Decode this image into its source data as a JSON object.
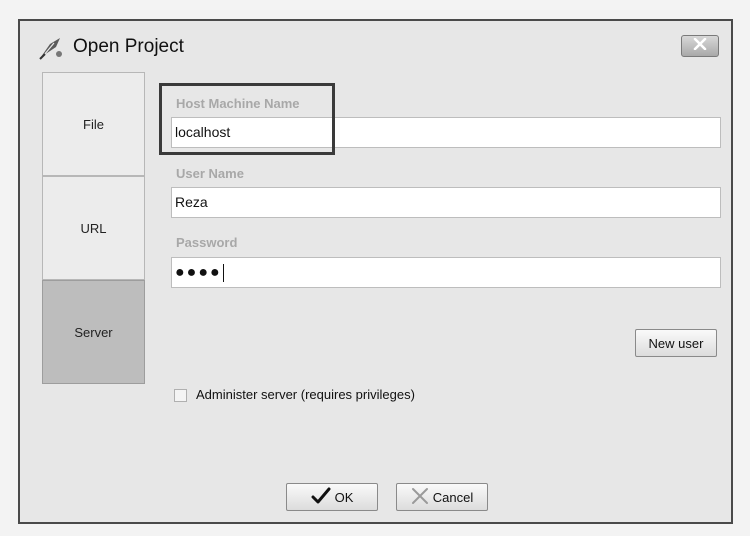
{
  "window": {
    "title": "Open Project",
    "app_icon": "feather-quill-icon",
    "close_icon": "close-icon"
  },
  "sidebar": {
    "items": [
      {
        "label": "File",
        "selected": false
      },
      {
        "label": "URL",
        "selected": false
      },
      {
        "label": "Server",
        "selected": true
      }
    ]
  },
  "form": {
    "host": {
      "label": "Host Machine Name",
      "value": "localhost"
    },
    "user": {
      "label": "User Name",
      "value": "Reza"
    },
    "password": {
      "label": "Password",
      "value": "●●●●"
    },
    "new_user_label": "New user",
    "administer_label": "Administer server (requires privileges)",
    "administer_checked": false
  },
  "footer": {
    "ok_label": "OK",
    "cancel_label": "Cancel",
    "ok_icon": "checkmark-icon",
    "cancel_icon": "x-icon"
  },
  "colors": {
    "dialog_bg": "#e7e7e7",
    "selected_tab": "#bdbdbd",
    "label_gray": "#a8a8a8",
    "highlight_border": "#3a3a3a"
  }
}
